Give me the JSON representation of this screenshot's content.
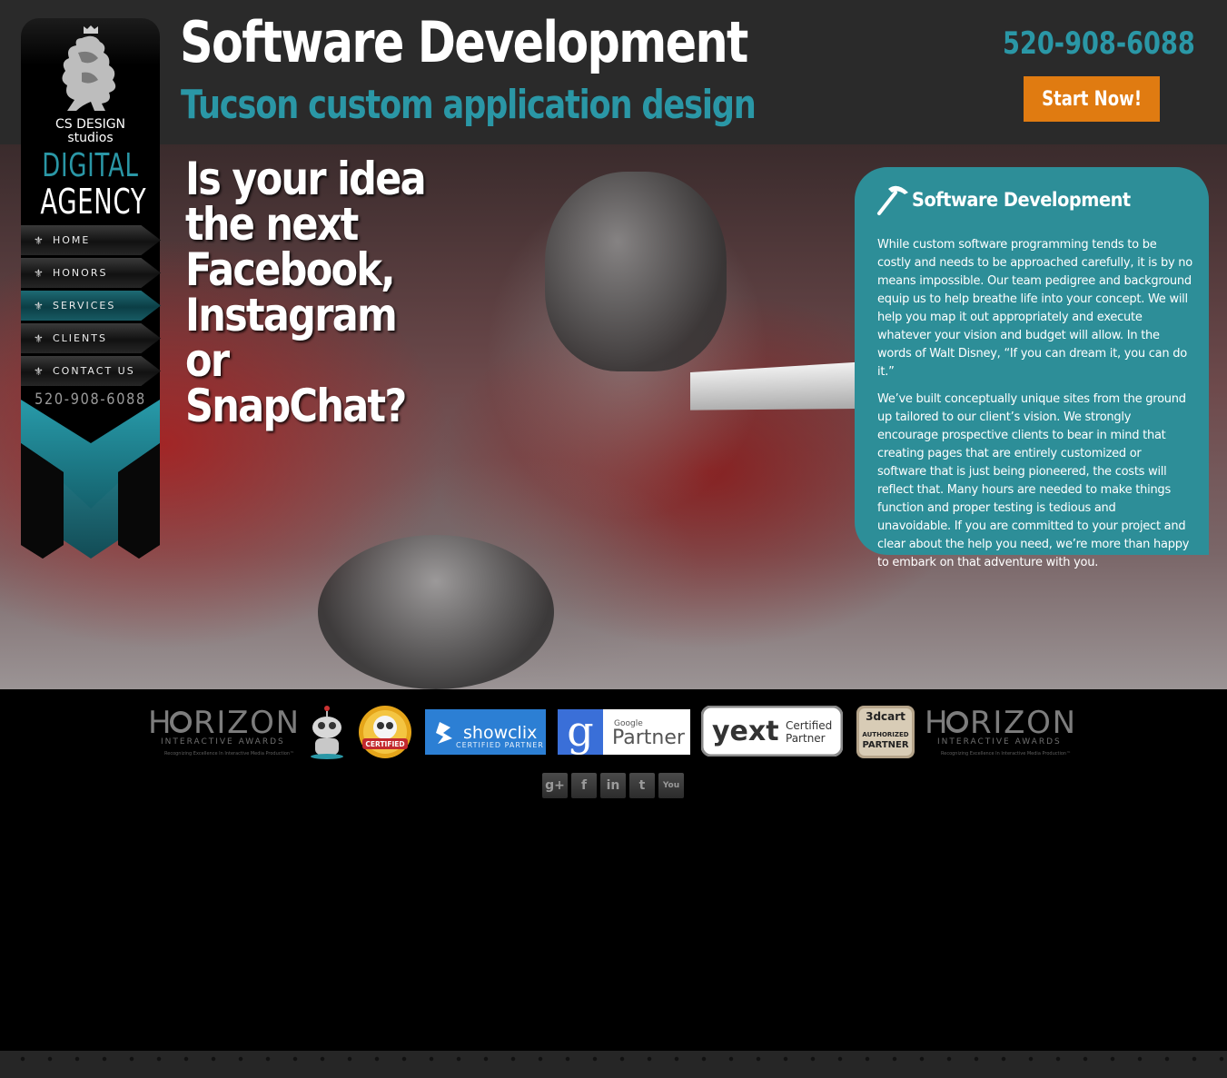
{
  "header": {
    "title": "Software Development",
    "subtitle": "Tucson custom application design",
    "phone": "520-908-6088",
    "cta_label": "Start Now!"
  },
  "hero": {
    "headline": "Is your idea the next Facebook, Instagram or SnapChat?"
  },
  "panel": {
    "icon": "hammer-icon",
    "title": "Software Development",
    "paragraphs": [
      "While custom software programming tends to be costly and needs to be approached carefully, it is by no means impossible. Our team pedigree and background equip us to help breathe life into your concept. We will help you map it out appropriately and execute whatever your vision and budget will allow. In the words of Walt Disney, “If you can dream it, you can do it.”",
      "We’ve built conceptually unique sites from the ground up tailored to our client’s vision. We strongly encourage prospective clients to bear in mind that creating pages that are entirely customized or software that is just being pioneered, the costs will reflect that. Many hours are needed to make things function and proper testing is tedious and unavoidable. If you are committed to your project and clear about the help you need, we’re more than happy to embark on that adventure with you."
    ]
  },
  "sidebar": {
    "brand_line1": "CS DESIGN",
    "brand_line2": "studios",
    "brand_digital": "DIGITAL",
    "brand_agency": "AGENCY",
    "phone": "520-908-6088",
    "nav": [
      {
        "label": "HOME",
        "active": false
      },
      {
        "label": "HONORS",
        "active": false
      },
      {
        "label": "SERVICES",
        "active": true
      },
      {
        "label": "CLIENTS",
        "active": false
      },
      {
        "label": "CONTACT US",
        "active": false
      }
    ]
  },
  "badges": {
    "horizon": {
      "word": "RIZON",
      "lead": "H",
      "line2": "INTERACTIVE AWARDS",
      "line3": "Recognizing Excellence In Interactive Media Production™"
    },
    "hootsuite": {
      "label": "CERTIFIED"
    },
    "showclix": {
      "name": "showclix",
      "line2": "CERTIFIED PARTNER"
    },
    "google": {
      "small": "Google",
      "big": "Partner"
    },
    "yext": {
      "name": "yext",
      "line1": "Certified",
      "line2": "Partner"
    },
    "threedcart": {
      "name": "3dcart",
      "line1": "AUTHORIZED",
      "line2": "PARTNER"
    }
  },
  "social": [
    "g+",
    "f",
    "in",
    "t",
    "You"
  ],
  "colors": {
    "accent_teal": "#2a97a6",
    "panel_teal": "#2d8e98",
    "cta_orange": "#e07b11",
    "header_bg": "#2a2a2a"
  }
}
